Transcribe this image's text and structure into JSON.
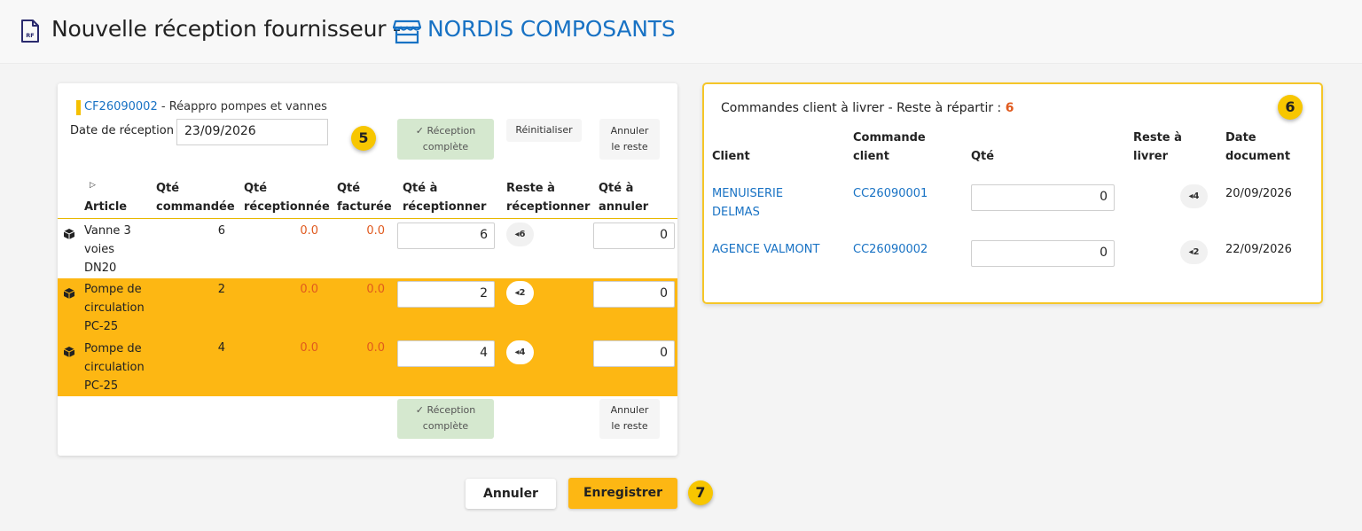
{
  "header": {
    "title": "Nouvelle réception fournisseur -",
    "supplier": "NORDIS COMPOSANTS",
    "doc_icon": "document-rf-icon",
    "store_icon": "store-icon",
    "doc_icon_text": "RF"
  },
  "reception": {
    "order_code": "CF26090002",
    "order_desc": " - Réappro pompes et vannes",
    "date_label": "Date de réception",
    "date_value": "23/09/2026",
    "step_badge": "5",
    "btn_complete_line1": "✓ Réception",
    "btn_complete_line2": "complète",
    "btn_reset": "Réinitialiser",
    "btn_cancel_rest_line1": "Annuler",
    "btn_cancel_rest_line2": "le reste",
    "columns": {
      "article": "Article",
      "qte_commandee": [
        "Qté",
        "commandée"
      ],
      "qte_receptionnee": [
        "Qté",
        "réceptionnée"
      ],
      "qte_facturee": [
        "Qté",
        "facturée"
      ],
      "qte_a_receptionner": [
        "Qté à",
        "réceptionner"
      ],
      "reste_a_receptionner": [
        "Reste à",
        "réceptionner"
      ],
      "qte_a_annuler": [
        "Qté à",
        "annuler"
      ]
    },
    "rows": [
      {
        "article": [
          "Vanne 3",
          "voies",
          "DN20"
        ],
        "qte_commandee": "6",
        "qte_receptionnee": "0.0",
        "qte_facturee": "0.0",
        "qte_a_receptionner": "6",
        "reste": "6",
        "qte_a_annuler": "0",
        "highlighted": false
      },
      {
        "article": [
          "Pompe de",
          "circulation",
          "PC-25"
        ],
        "qte_commandee": "2",
        "qte_receptionnee": "0.0",
        "qte_facturee": "0.0",
        "qte_a_receptionner": "2",
        "reste": "2",
        "qte_a_annuler": "0",
        "highlighted": true
      },
      {
        "article": [
          "Pompe de",
          "circulation",
          "PC-25"
        ],
        "qte_commandee": "4",
        "qte_receptionnee": "0.0",
        "qte_facturee": "0.0",
        "qte_a_receptionner": "4",
        "reste": "4",
        "qte_a_annuler": "0",
        "highlighted": true
      }
    ]
  },
  "client_orders": {
    "title": "Commandes client à livrer - Reste à répartir : ",
    "remaining": "6",
    "step_badge": "6",
    "columns": {
      "client": "Client",
      "commande": [
        "Commande",
        "client"
      ],
      "qte": "Qté",
      "reste": [
        "Reste à",
        "livrer"
      ],
      "date": [
        "Date",
        "document"
      ]
    },
    "rows": [
      {
        "client": [
          "MENUISERIE",
          "DELMAS"
        ],
        "commande": "CC26090001",
        "qte": "0",
        "reste": "4",
        "date": "20/09/2026"
      },
      {
        "client": [
          "AGENCE VALMONT"
        ],
        "commande": "CC26090002",
        "qte": "0",
        "reste": "2",
        "date": "22/09/2026"
      }
    ]
  },
  "footer": {
    "cancel": "Annuler",
    "save": "Enregistrer",
    "step_badge": "7"
  },
  "colors": {
    "accent": "#fdb713",
    "link": "#1872c4",
    "warning_text": "#e05a1e",
    "complete_button": "#d5e8cf"
  }
}
